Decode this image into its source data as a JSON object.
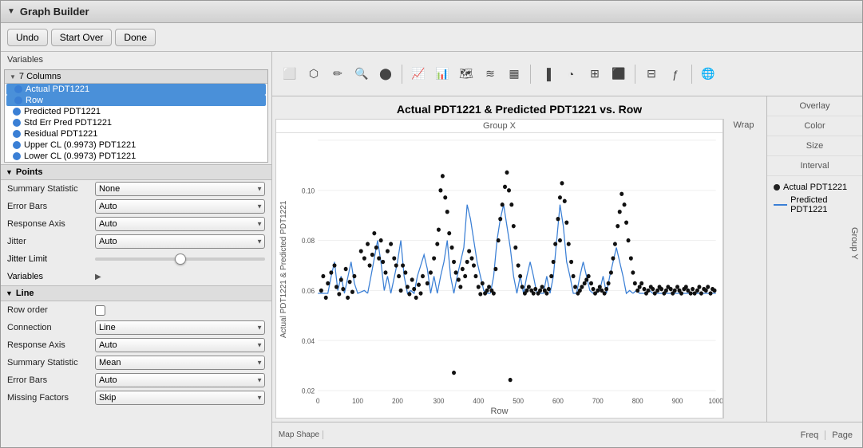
{
  "window": {
    "title": "Graph Builder"
  },
  "toolbar": {
    "undo_label": "Undo",
    "start_over_label": "Start Over",
    "done_label": "Done"
  },
  "variables_section": {
    "label": "Variables",
    "columns_header": "7 Columns",
    "columns": [
      {
        "name": "Actual PDT1221",
        "selected": true
      },
      {
        "name": "Row",
        "selected": true
      },
      {
        "name": "Predicted PDT1221",
        "selected": false
      },
      {
        "name": "Std Err Pred PDT1221",
        "selected": false
      },
      {
        "name": "Residual PDT1221",
        "selected": false
      },
      {
        "name": "Upper CL (0.9973) PDT1221",
        "selected": false
      },
      {
        "name": "Lower CL (0.9973) PDT1221",
        "selected": false
      }
    ]
  },
  "points_section": {
    "label": "Points",
    "summary_statistic_label": "Summary Statistic",
    "summary_statistic_value": "None",
    "error_bars_label": "Error Bars",
    "error_bars_value": "Auto",
    "response_axis_label": "Response Axis",
    "response_axis_value": "Auto",
    "jitter_label": "Jitter",
    "jitter_value": "Auto",
    "jitter_limit_label": "Jitter Limit",
    "variables_label": "Variables"
  },
  "line_section": {
    "label": "Line",
    "row_order_label": "Row order",
    "connection_label": "Connection",
    "connection_value": "Line",
    "response_axis_label": "Response Axis",
    "response_axis_value": "Auto",
    "summary_statistic_label": "Summary Statistic",
    "summary_statistic_value": "Mean",
    "error_bars_label": "Error Bars",
    "error_bars_value": "Auto",
    "missing_factors_label": "Missing Factors",
    "missing_factors_value": "Skip"
  },
  "graph": {
    "title": "Actual PDT1221 & Predicted PDT1221 vs. Row",
    "group_x_label": "Group X",
    "group_y_label": "Group Y",
    "wrap_label": "Wrap",
    "y_axis_label": "Actual PDT1221 & Predicted PDT1221",
    "x_axis_label": "Row",
    "x_ticks": [
      "0",
      "100",
      "200",
      "300",
      "400",
      "500",
      "600",
      "700",
      "800",
      "900",
      "1000"
    ],
    "y_ticks": [
      "0.02",
      "0.04",
      "0.06",
      "0.08",
      "0.10"
    ],
    "overlay_label": "Overlay",
    "color_label": "Color",
    "size_label": "Size",
    "interval_label": "Interval"
  },
  "legend": {
    "items": [
      {
        "label": "Actual PDT1221",
        "type": "dot"
      },
      {
        "label": "Predicted PDT1221",
        "type": "line"
      }
    ]
  },
  "bottom": {
    "map_shape": "Map Shape",
    "freq": "Freq",
    "page": "Page"
  }
}
